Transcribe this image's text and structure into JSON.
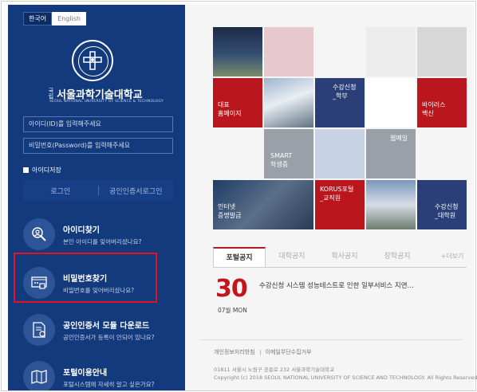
{
  "lang": {
    "korean": "한국어",
    "english": "English"
  },
  "university": {
    "small_prefix": "국립",
    "name_ko": "서울과학기술대학교",
    "name_en": "SEOUL NATIONAL UNIVERSITY OF SCIENCE & TECHNOLOGY"
  },
  "login": {
    "id_placeholder": "아이디(ID)를 입력해주세요",
    "pw_placeholder": "비밀번호(Password)를 입력해주세요",
    "save_id": "아이디저장",
    "login_button": "로그인",
    "cert_login_button": "공인인증서로그인"
  },
  "menus": [
    {
      "title": "아이디찾기",
      "desc": "본인 아이디를 잊어버리셨나요?"
    },
    {
      "title": "비밀번호찾기",
      "desc": "비밀번호를 잊어버리셨나요?"
    },
    {
      "title": "공인인증서 모듈 다운로드",
      "desc": "공인인증서가 등록이 안되어 있나요?"
    },
    {
      "title": "포털이용안내",
      "desc": "포털시스템에 자세히 알고 싶은가요?"
    }
  ],
  "tiles": {
    "homepage": "대표\n홈페이지",
    "course_ug": "수강신청\n_학부",
    "virus": "바이러스\n백신",
    "smart": "SMART\n학생증",
    "webmail": "웹메일",
    "cert_issue": "인터넷\n증명발급",
    "korus": "KORUS포털\n_교직원",
    "course_grad": "수강신청\n_대학원"
  },
  "tabs": [
    "포털공지",
    "대학공지",
    "학사공지",
    "장학공지"
  ],
  "more": "+더보기",
  "notice": {
    "day": "30",
    "month": "07월 MON",
    "text": "수강신청 시스템 성능테스트로 인한 일부서비스 지연…"
  },
  "footer": {
    "privacy": "개인정보처리방침",
    "email_policy": "이메일무단수집거부",
    "address": "01811 서울시 노원구 공릉로 232 서울과학기술대학교",
    "copyright": "Copyright (c) 2018 SEOUL NATIONAL UNIVERSITY OF SCIENCE AND TECHNOLOGY. All Rights Reserved."
  },
  "colors": {
    "navy": "#123a7c",
    "red": "#b9161e",
    "highlight": "#e5121d"
  }
}
